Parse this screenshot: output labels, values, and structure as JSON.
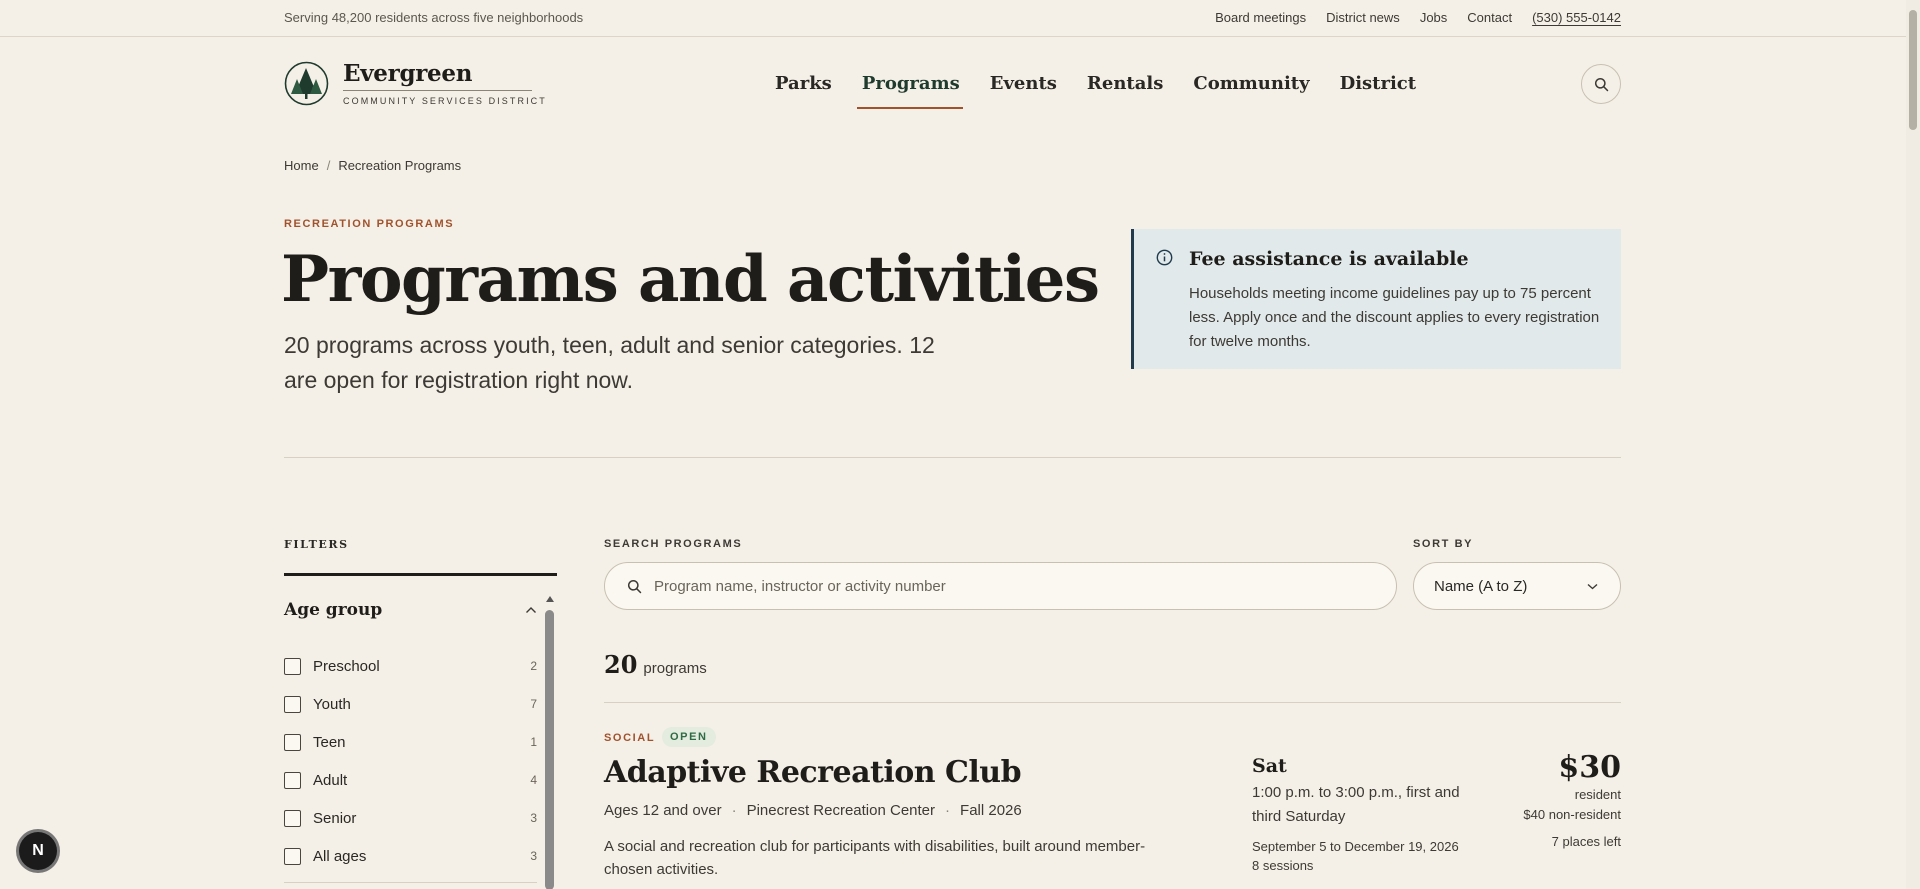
{
  "utility": {
    "tagline": "Serving 48,200 residents across five neighborhoods",
    "links": [
      "Board meetings",
      "District news",
      "Jobs",
      "Contact"
    ],
    "phone": "(530) 555-0142"
  },
  "logo": {
    "name": "Evergreen",
    "sub": "COMMUNITY SERVICES DISTRICT"
  },
  "nav": {
    "items": [
      "Parks",
      "Programs",
      "Events",
      "Rentals",
      "Community",
      "District"
    ],
    "active": "Programs"
  },
  "breadcrumb": {
    "home": "Home",
    "separator": "/",
    "current": "Recreation Programs"
  },
  "hero": {
    "eyebrow": "RECREATION PROGRAMS",
    "title": "Programs and activities",
    "description": "20 programs across youth, teen, adult and senior categories. 12 are open for registration right now."
  },
  "fee_notice": {
    "title": "Fee assistance is available",
    "text": "Households meeting income guidelines pay up to 75 percent less. Apply once and the discount applies to every registration for twelve months."
  },
  "filters": {
    "label": "FILTERS",
    "age_group": {
      "title": "Age group",
      "options": [
        {
          "label": "Preschool",
          "count": "2"
        },
        {
          "label": "Youth",
          "count": "7"
        },
        {
          "label": "Teen",
          "count": "1"
        },
        {
          "label": "Adult",
          "count": "4"
        },
        {
          "label": "Senior",
          "count": "3"
        },
        {
          "label": "All ages",
          "count": "3"
        }
      ]
    }
  },
  "search": {
    "label": "SEARCH PROGRAMS",
    "placeholder": "Program name, instructor or activity number"
  },
  "sort": {
    "label": "SORT BY",
    "value": "Name (A to Z)"
  },
  "results": {
    "count": "20",
    "unit": "programs"
  },
  "program": {
    "category": "SOCIAL",
    "status": "OPEN",
    "title": "Adaptive Recreation Club",
    "meta": [
      "Ages 12 and over",
      "Pinecrest Recreation Center",
      "Fall 2026"
    ],
    "meta_sep": "·",
    "description": "A social and recreation club for participants with disabilities, built around member-chosen activities.",
    "day": "Sat",
    "time": "1:00 p.m. to 3:00 p.m., first and third Saturday",
    "dates": "September 5 to December 19, 2026",
    "sessions": "8 sessions",
    "price": "$30",
    "price_note": "resident",
    "price_nonres": "$40 non-resident",
    "spots": "7 places left"
  },
  "badge": {
    "letter": "N"
  },
  "colors": {
    "background": "#f5f0e7",
    "accent": "#a0522d",
    "forest": "#1f3b2d",
    "info_bg": "#e1e9ea",
    "open_green": "#2f6b45"
  }
}
